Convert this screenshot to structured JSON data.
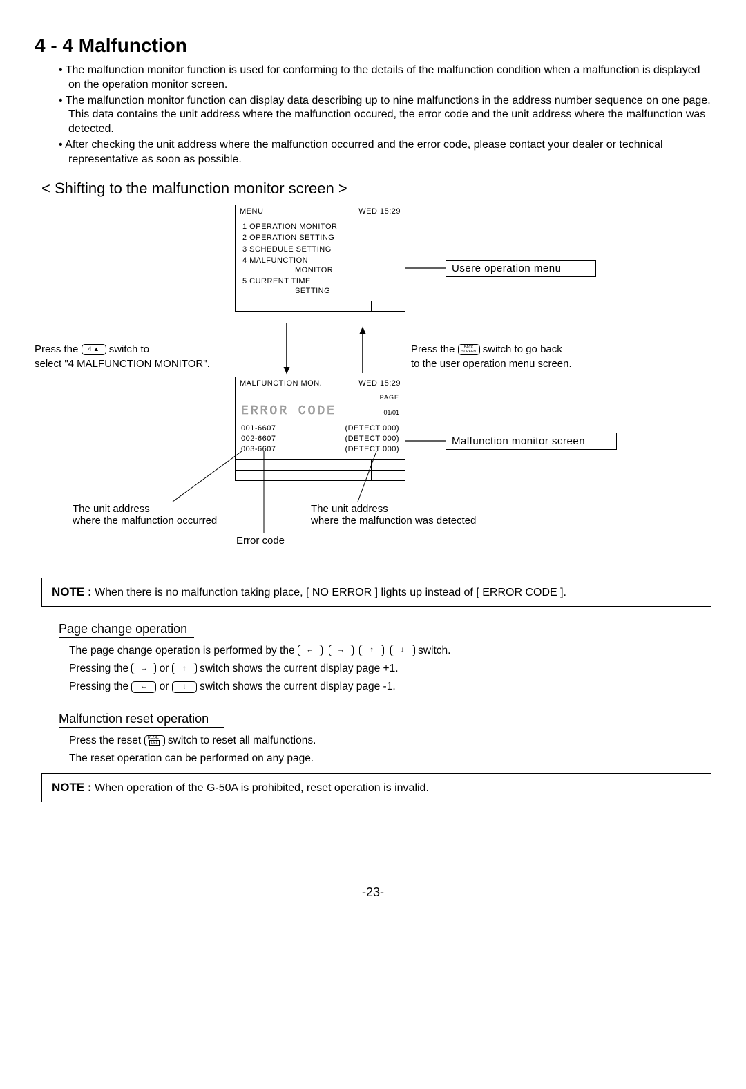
{
  "title": "4 - 4 Malfunction",
  "bullets": [
    "• The malfunction monitor function is used for conforming to the details of the malfunction condition when a malfunction is displayed on the operation monitor screen.",
    "• The malfunction monitor function can display data describing up to nine malfunctions in the address number sequence on one page. This data contains the unit address where the malfunction occured, the error code and the unit address where the  malfunction was detected.",
    "• After checking the unit address where the malfunction occurred and the error code, please contact your dealer or technical representative as soon as possible."
  ],
  "subheading": "< Shifting to the malfunction monitor screen >",
  "menu": {
    "header_left": "MENU",
    "header_right": "WED  15:29",
    "items": [
      "1 OPERATION MONITOR",
      "2 OPERATION SETTING",
      "3 SCHEDULE SETTING",
      "4 MALFUNCTION",
      "5 CURRENT TIME"
    ],
    "item4_sub": "MONITOR",
    "item5_sub": "SETTING"
  },
  "side_usermenu": "Usere operation menu",
  "left_instr_1": "Press the ",
  "left_instr_key": "4  ▲",
  "left_instr_2": " switch to",
  "left_instr_3": "select \"4 MALFUNCTION MONITOR\".",
  "right_instr_1": "Press the ",
  "right_instr_key": "BACK\nSCREEN",
  "right_instr_2": " switch to go back",
  "right_instr_3": "to the user operation menu screen.",
  "mal": {
    "header_left": "MALFUNCTION MON.",
    "header_right": "WED  15:29",
    "page_label": "PAGE",
    "page_value": "01/01",
    "error_code": "ERROR CODE",
    "rows": [
      {
        "addr": "001-6607",
        "detect": "(DETECT 000)"
      },
      {
        "addr": "002-6607",
        "detect": "(DETECT 000)"
      },
      {
        "addr": "003-6607",
        "detect": "(DETECT 000)"
      }
    ]
  },
  "side_malmon": "Malfunction monitor screen",
  "callout_unit_occ_1": "The unit address",
  "callout_unit_occ_2": "where the malfunction occurred",
  "callout_errcode": "Error code",
  "callout_unit_det_1": "The unit address",
  "callout_unit_det_2": "where the malfunction was detected",
  "note1_bold": "NOTE :",
  "note1_text": " When there is no malfunction taking place, [ NO ERROR ] lights up instead of [ ERROR CODE ].",
  "op_page_title": "Page change operation",
  "op_page_lines": {
    "l1a": "The page change operation is performed by the ",
    "l1b": " switch.",
    "l2a": "Pressing the ",
    "l2b": " or ",
    "l2c": " switch shows the current display page +1.",
    "l3a": "Pressing the ",
    "l3b": " or ",
    "l3c": " switch shows the current display page -1."
  },
  "op_reset_title": "Malfunction reset operation",
  "op_reset_lines": {
    "l1a": "Press the reset ",
    "l1b": " switch to reset all malfunctions.",
    "l2": "The reset operation can be performed on any page."
  },
  "reset_key": "RESET\nDEL",
  "note2_bold": "NOTE :",
  "note2_text": " When operation of the G-50A is prohibited, reset operation is invalid.",
  "pagenum": "-23-"
}
